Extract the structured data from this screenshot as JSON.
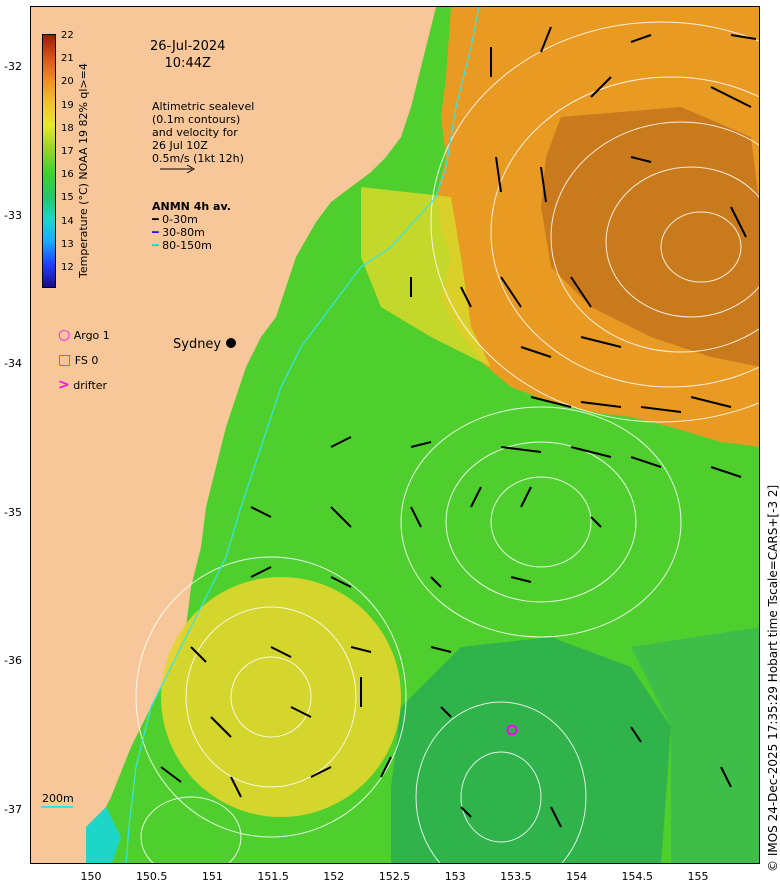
{
  "date": "26-Jul-2024",
  "time": "10:44Z",
  "colorbar": {
    "title": "Temperature (°C) NOAA 19 82% ql>=4",
    "ticks": [
      "22",
      "21",
      "20",
      "19",
      "18",
      "17",
      "16",
      "15",
      "14",
      "13",
      "12"
    ]
  },
  "sealevel_note": [
    "Altimetric sealevel",
    "(0.1m contours)",
    "and velocity for",
    "26 Jul 10Z",
    "0.5m/s (1kt 12h)"
  ],
  "anmn": {
    "title": "ANMN 4h av.",
    "items": [
      {
        "label": "0-30m",
        "color": "#000000"
      },
      {
        "label": "30-80m",
        "color": "#1a1aff"
      },
      {
        "label": "80-150m",
        "color": "#00e0e0"
      }
    ]
  },
  "platforms": [
    {
      "label": "Argo 1",
      "color": "#ff00ff",
      "icon": "circle-icon"
    },
    {
      "label": "FS 0",
      "color": "#ff00ff",
      "icon": "square-icon"
    },
    {
      "label": "drifter",
      "color": "#ff00ff",
      "icon": "chevron-icon"
    }
  ],
  "city": "Sydney",
  "isobath_label": "200m",
  "lat_labels": [
    "-32",
    "-33",
    "-34",
    "-35",
    "-36",
    "-37"
  ],
  "lon_labels": [
    "150",
    "150.5",
    "151",
    "151.5",
    "152",
    "152.5",
    "153",
    "153.5",
    "154",
    "154.5",
    "155"
  ],
  "credit": "© IMOS 24-Dec-2025 17:35:29 Hobart time Tscale=CARS+[-3 2]"
}
